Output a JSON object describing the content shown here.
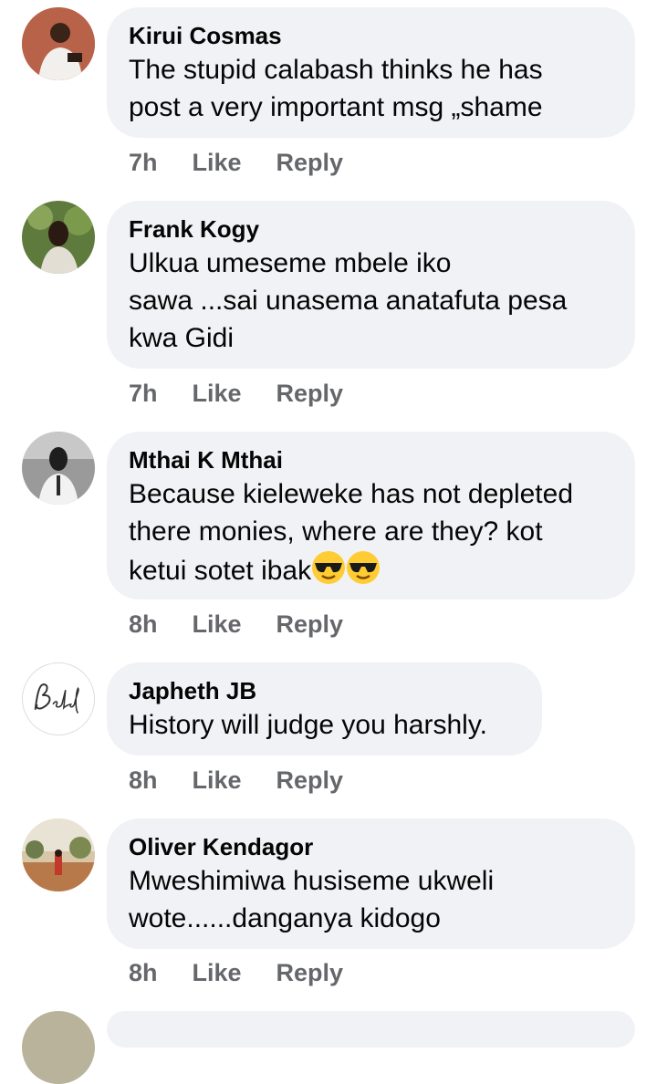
{
  "comments": [
    {
      "author": "Kirui Cosmas",
      "text_lines": [
        "The stupid calabash thinks he has",
        "post a very important msg „shame"
      ],
      "time": "7h",
      "like": "Like",
      "reply": "Reply"
    },
    {
      "author": "Frank Kogy",
      "text_lines": [
        "Ulkua umeseme mbele iko",
        "sawa ...sai unasema anatafuta pesa",
        "kwa Gidi"
      ],
      "time": "7h",
      "like": "Like",
      "reply": "Reply"
    },
    {
      "author": "Mthai K Mthai",
      "text_lines": [
        "Because kieleweke has not depleted",
        "there monies, where are they? kot",
        "ketui sotet ibak"
      ],
      "emojis": [
        "smiling-face-with-sunglasses",
        "smiling-face-with-sunglasses"
      ],
      "time": "8h",
      "like": "Like",
      "reply": "Reply"
    },
    {
      "author": "Japheth JB",
      "text_lines": [
        "History will judge you harshly."
      ],
      "avatar_logo_text": "Belief",
      "time": "8h",
      "like": "Like",
      "reply": "Reply"
    },
    {
      "author": "Oliver Kendagor",
      "text_lines": [
        "Mweshimiwa husiseme ukweli",
        "wote......danganya kidogo"
      ],
      "time": "8h",
      "like": "Like",
      "reply": "Reply"
    }
  ]
}
